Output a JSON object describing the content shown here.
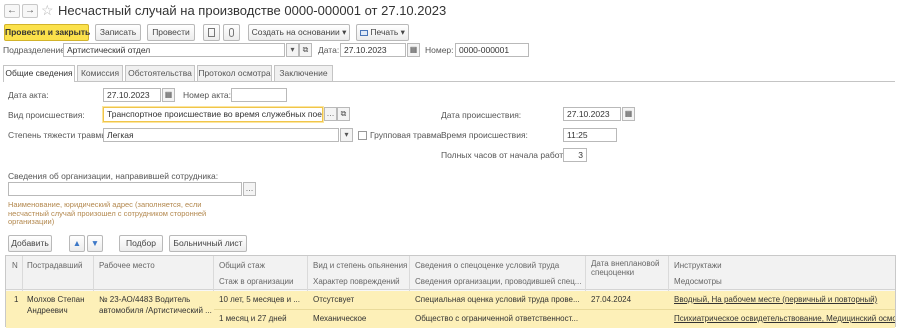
{
  "window": {
    "title": "Несчастный случай на производстве 0000-000001 от 27.10.2023",
    "back_glyph": "←",
    "forward_glyph": "→",
    "star_glyph": "☆"
  },
  "toolbar": {
    "post_close": "Провести и закрыть",
    "save": "Записать",
    "post": "Провести",
    "create_based": "Создать на основании",
    "print": "Печать",
    "dropdown_glyph": "▾"
  },
  "header": {
    "department_label": "Подразделение:",
    "department_value": "Артистический отдел",
    "date_label": "Дата:",
    "date_value": "27.10.2023",
    "number_label": "Номер:",
    "number_value": "0000-000001"
  },
  "tabs": [
    "Общие сведения",
    "Комиссия",
    "Обстоятельства",
    "Протокол осмотра",
    "Заключение"
  ],
  "form": {
    "act_date_label": "Дата акта:",
    "act_date_value": "27.10.2023",
    "act_number_label": "Номер акта:",
    "act_number_value": "",
    "incident_type_label": "Вид происшествия:",
    "incident_type_value": "Транспортное происшествие во время служебных поездок (",
    "severity_label": "Степень тяжести травмы:",
    "severity_value": "Легкая",
    "group_injury_label": "Групповая травма",
    "incident_date_label": "Дата происшествия:",
    "incident_date_value": "27.10.2023",
    "incident_time_label": "Время происшествия:",
    "incident_time_value": "11:25",
    "hours_label": "Полных часов от начала работы:",
    "hours_value": "3",
    "org_label": "Сведения об организации, направившей сотрудника:",
    "org_value": "",
    "org_hint": "Наименование, юридический адрес (заполняется, если несчастный случай произошел с сотрудником сторонней организации)"
  },
  "table_toolbar": {
    "add": "Добавить",
    "up_glyph": "🡅",
    "down_glyph": "🡇",
    "select": "Подбор",
    "sick_leave": "Больничный лист"
  },
  "table": {
    "headers": {
      "n": "N",
      "victim": "Пострадавший",
      "workplace": "Рабочее место",
      "experience": "Общий стаж",
      "experience_org": "Стаж в организации",
      "intoxication": "Вид и степень опьянения",
      "injury_nature": "Характер повреждений",
      "sout": "Сведения о спецоценке условий труда",
      "sout_org": "Сведения организации, проводившей спец...",
      "unscheduled_date": "Дата внеплановой спецоценки",
      "briefings": "Инструктажи",
      "medical": "Медосмотры"
    },
    "rows": [
      {
        "n": "1",
        "victim": "Молхов Степан Андреевич",
        "workplace": "№ 23-АО/4483 Водитель автомобиля /Артистический ...",
        "experience": "10 лет, 5 месяцев и ...",
        "experience_org": "1 месяц и 27 дней",
        "intoxication": "Отсутсвует",
        "injury_nature": "Механическое",
        "sout": "Специальная оценка условий труда прове...",
        "sout_org": "Общество с ограниченной ответственност...",
        "unscheduled_date": "27.04.2024",
        "briefings": "Вводный, На рабочем месте (первичный и повторный)",
        "medical": "Психиатрическое освидетельствование, Медицинский осмотр"
      }
    ]
  },
  "colors": {
    "accent_yellow": "#fbe14b",
    "selected_row": "#fdf0b8",
    "tab_border": "#c4c4c4"
  }
}
